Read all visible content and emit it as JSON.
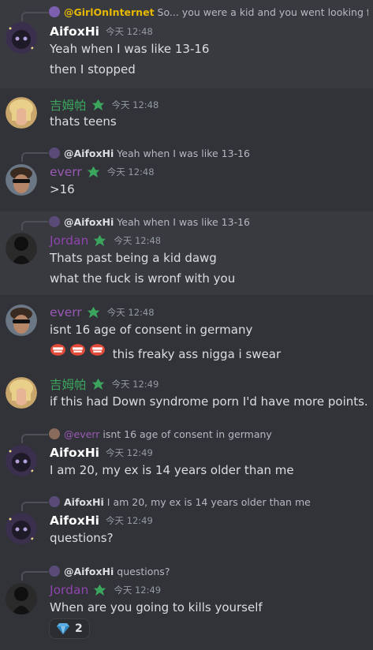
{
  "colors": {
    "background": "#313338",
    "aifoxhi": "#ffffff",
    "jiumupa": "#3ba55d",
    "everr": "#9b59b6",
    "jordan": "#8e44ad",
    "girlonline": "#e6b800",
    "timestamp": "#949ba4"
  },
  "messages": [
    {
      "reply": {
        "user": "@GirlOnInternet",
        "text": "So... you were a kid and you went looking for CP"
      },
      "user": "AifoxHi",
      "time": "今天 12:48",
      "lines": [
        "Yeah when I was like 13-16",
        "then I stopped"
      ]
    },
    {
      "user": "吉姆帕",
      "time": "今天 12:48",
      "lines": [
        "thats teens"
      ]
    },
    {
      "reply": {
        "user": "@AifoxHi",
        "text": "Yeah when I was like 13-16"
      },
      "user": "everr",
      "time": "今天 12:48",
      "lines": [
        ">16"
      ]
    },
    {
      "reply": {
        "user": "@AifoxHi",
        "text": "Yeah when I was like 13-16"
      },
      "user": "Jordan",
      "time": "今天 12:48",
      "lines": [
        "Thats past being a kid dawg",
        "what the fuck is wronf with you"
      ]
    },
    {
      "user": "everr",
      "time": "今天 12:48",
      "lines": [
        "isnt 16 age of consent in germany",
        "this freaky ass nigga i swear"
      ]
    },
    {
      "user": "吉姆帕",
      "time": "今天 12:49",
      "lines": [
        "if this had Down syndrome porn I'd have more points."
      ]
    },
    {
      "reply": {
        "user": "@everr",
        "text": "isnt 16 age of consent in germany"
      },
      "user": "AifoxHi",
      "time": "今天 12:49",
      "lines": [
        "I am 20, my ex is 14 years older than me"
      ]
    },
    {
      "reply": {
        "user": "AifoxHi",
        "text": "I am 20, my ex is 14 years older than me"
      },
      "user": "AifoxHi",
      "time": "今天 12:49",
      "lines": [
        "questions?"
      ]
    },
    {
      "reply": {
        "user": "@AifoxHi",
        "text": "questions?"
      },
      "user": "Jordan",
      "time": "今天 12:49",
      "lines": [
        "When are you going to kills yourself"
      ],
      "reaction": {
        "emoji": "gem-icon",
        "count": "2"
      }
    }
  ]
}
